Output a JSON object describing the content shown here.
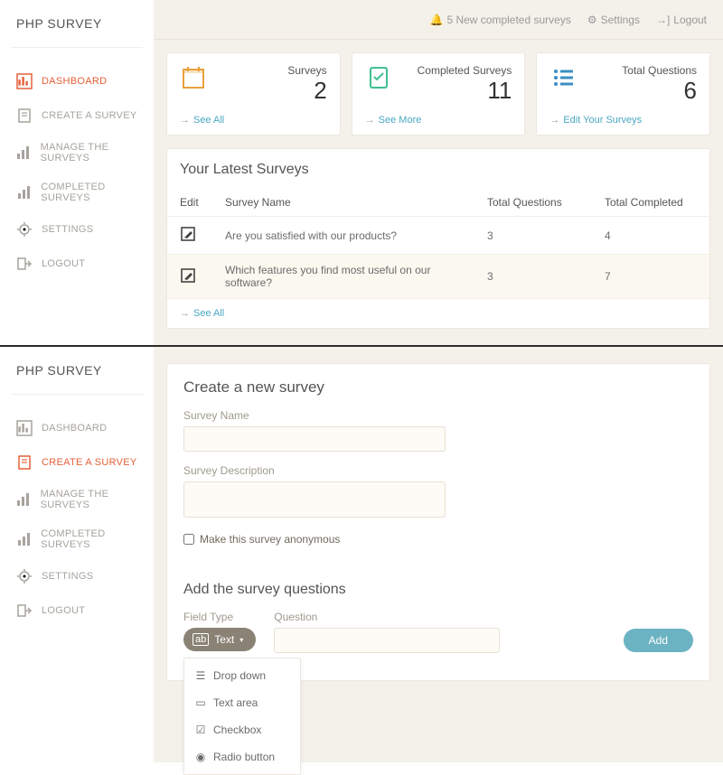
{
  "app": {
    "title": "PHP SURVEY"
  },
  "topbar": {
    "notifications": "5 New completed surveys",
    "settings": "Settings",
    "logout": "Logout"
  },
  "nav": {
    "items": [
      {
        "label": "DASHBOARD"
      },
      {
        "label": "CREATE A SURVEY"
      },
      {
        "label": "MANAGE THE SURVEYS"
      },
      {
        "label": "COMPLETED SURVEYS"
      },
      {
        "label": "SETTINGS"
      },
      {
        "label": "LOGOUT"
      }
    ]
  },
  "cards": {
    "surveys": {
      "label": "Surveys",
      "value": "2",
      "link": "See All"
    },
    "completed": {
      "label": "Completed Surveys",
      "value": "11",
      "link": "See More"
    },
    "questions": {
      "label": "Total Questions",
      "value": "6",
      "link": "Edit Your Surveys"
    }
  },
  "latest": {
    "title": "Your Latest Surveys",
    "headers": {
      "edit": "Edit",
      "name": "Survey Name",
      "questions": "Total Questions",
      "completed": "Total Completed"
    },
    "rows": [
      {
        "name": "Are you satisfied with our products?",
        "questions": "3",
        "completed": "4"
      },
      {
        "name": "Which features you find most useful on our software?",
        "questions": "3",
        "completed": "7"
      }
    ],
    "see_all": "See All"
  },
  "create": {
    "title": "Create a new survey",
    "name_label": "Survey Name",
    "desc_label": "Survey Description",
    "anon_label": "Make this survey anonymous",
    "questions_title": "Add the survey questions",
    "fieldtype_label": "Field Type",
    "question_label": "Question",
    "fieldtype_value": "Text",
    "add_btn": "Add",
    "dropdown": [
      {
        "label": "Drop down"
      },
      {
        "label": "Text area"
      },
      {
        "label": "Checkbox"
      },
      {
        "label": "Radio button"
      }
    ]
  }
}
